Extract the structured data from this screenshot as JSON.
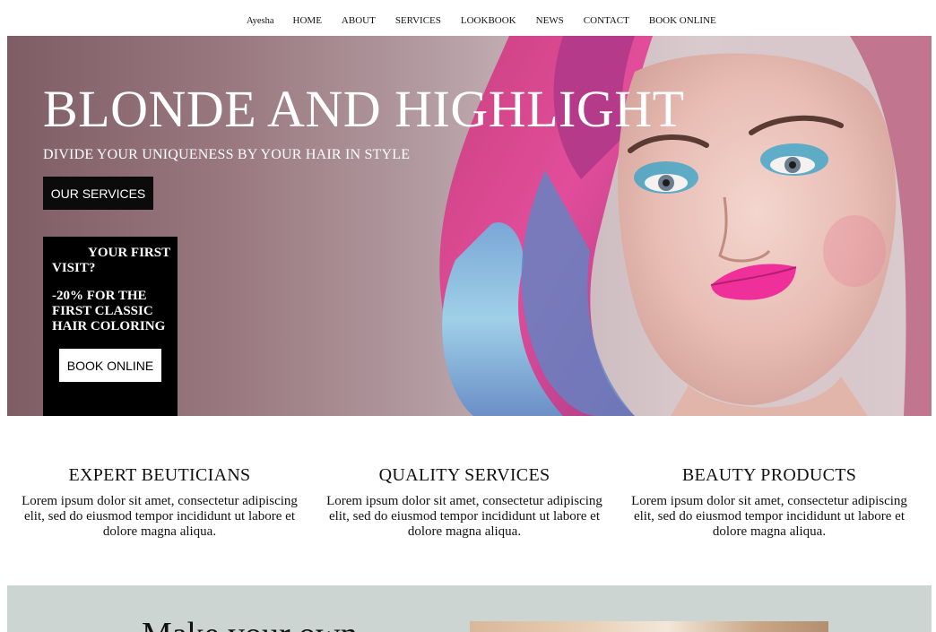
{
  "nav": {
    "brand": "Ayesha",
    "items": [
      {
        "label": "HOME"
      },
      {
        "label": "ABOUT"
      },
      {
        "label": "SERVICES"
      },
      {
        "label": "LOOKBOOK"
      },
      {
        "label": "NEWS"
      },
      {
        "label": "CONTACT"
      },
      {
        "label": "BOOK ONLINE"
      }
    ]
  },
  "hero": {
    "title": "BLONDE AND HIGHLIGHT",
    "subtitle": "DIVIDE YOUR UNIQUENESS BY YOUR HAIR IN STYLE",
    "services_button": "OUR SERVICES",
    "promo": {
      "question": "YOUR FIRST VISIT?",
      "offer": "-20% FOR THE FIRST CLASSIC HAIR COLORING",
      "book_button": "BOOK ONLINE"
    }
  },
  "features": [
    {
      "title": "EXPERT BEUTICIANS",
      "text": "Lorem ipsum dolor sit amet, consectetur adipiscing elit, sed do eiusmod tempor incididunt ut labore et dolore magna aliqua."
    },
    {
      "title": "QUALITY SERVICES",
      "text": "Lorem ipsum dolor sit amet, consectetur adipiscing elit, sed do eiusmod tempor incididunt ut labore et dolore magna aliqua."
    },
    {
      "title": "BEAUTY PRODUCTS",
      "text": "Lorem ipsum dolor sit amet, consectetur adipiscing elit, sed do eiusmod tempor incididunt ut labore et dolore magna aliqua."
    }
  ],
  "bottom": {
    "title": "Make your own"
  },
  "colors": {
    "hero_text": "#ffffff",
    "button_dark": "#0b0b0b",
    "bottom_bg": "#cdd5d3"
  }
}
